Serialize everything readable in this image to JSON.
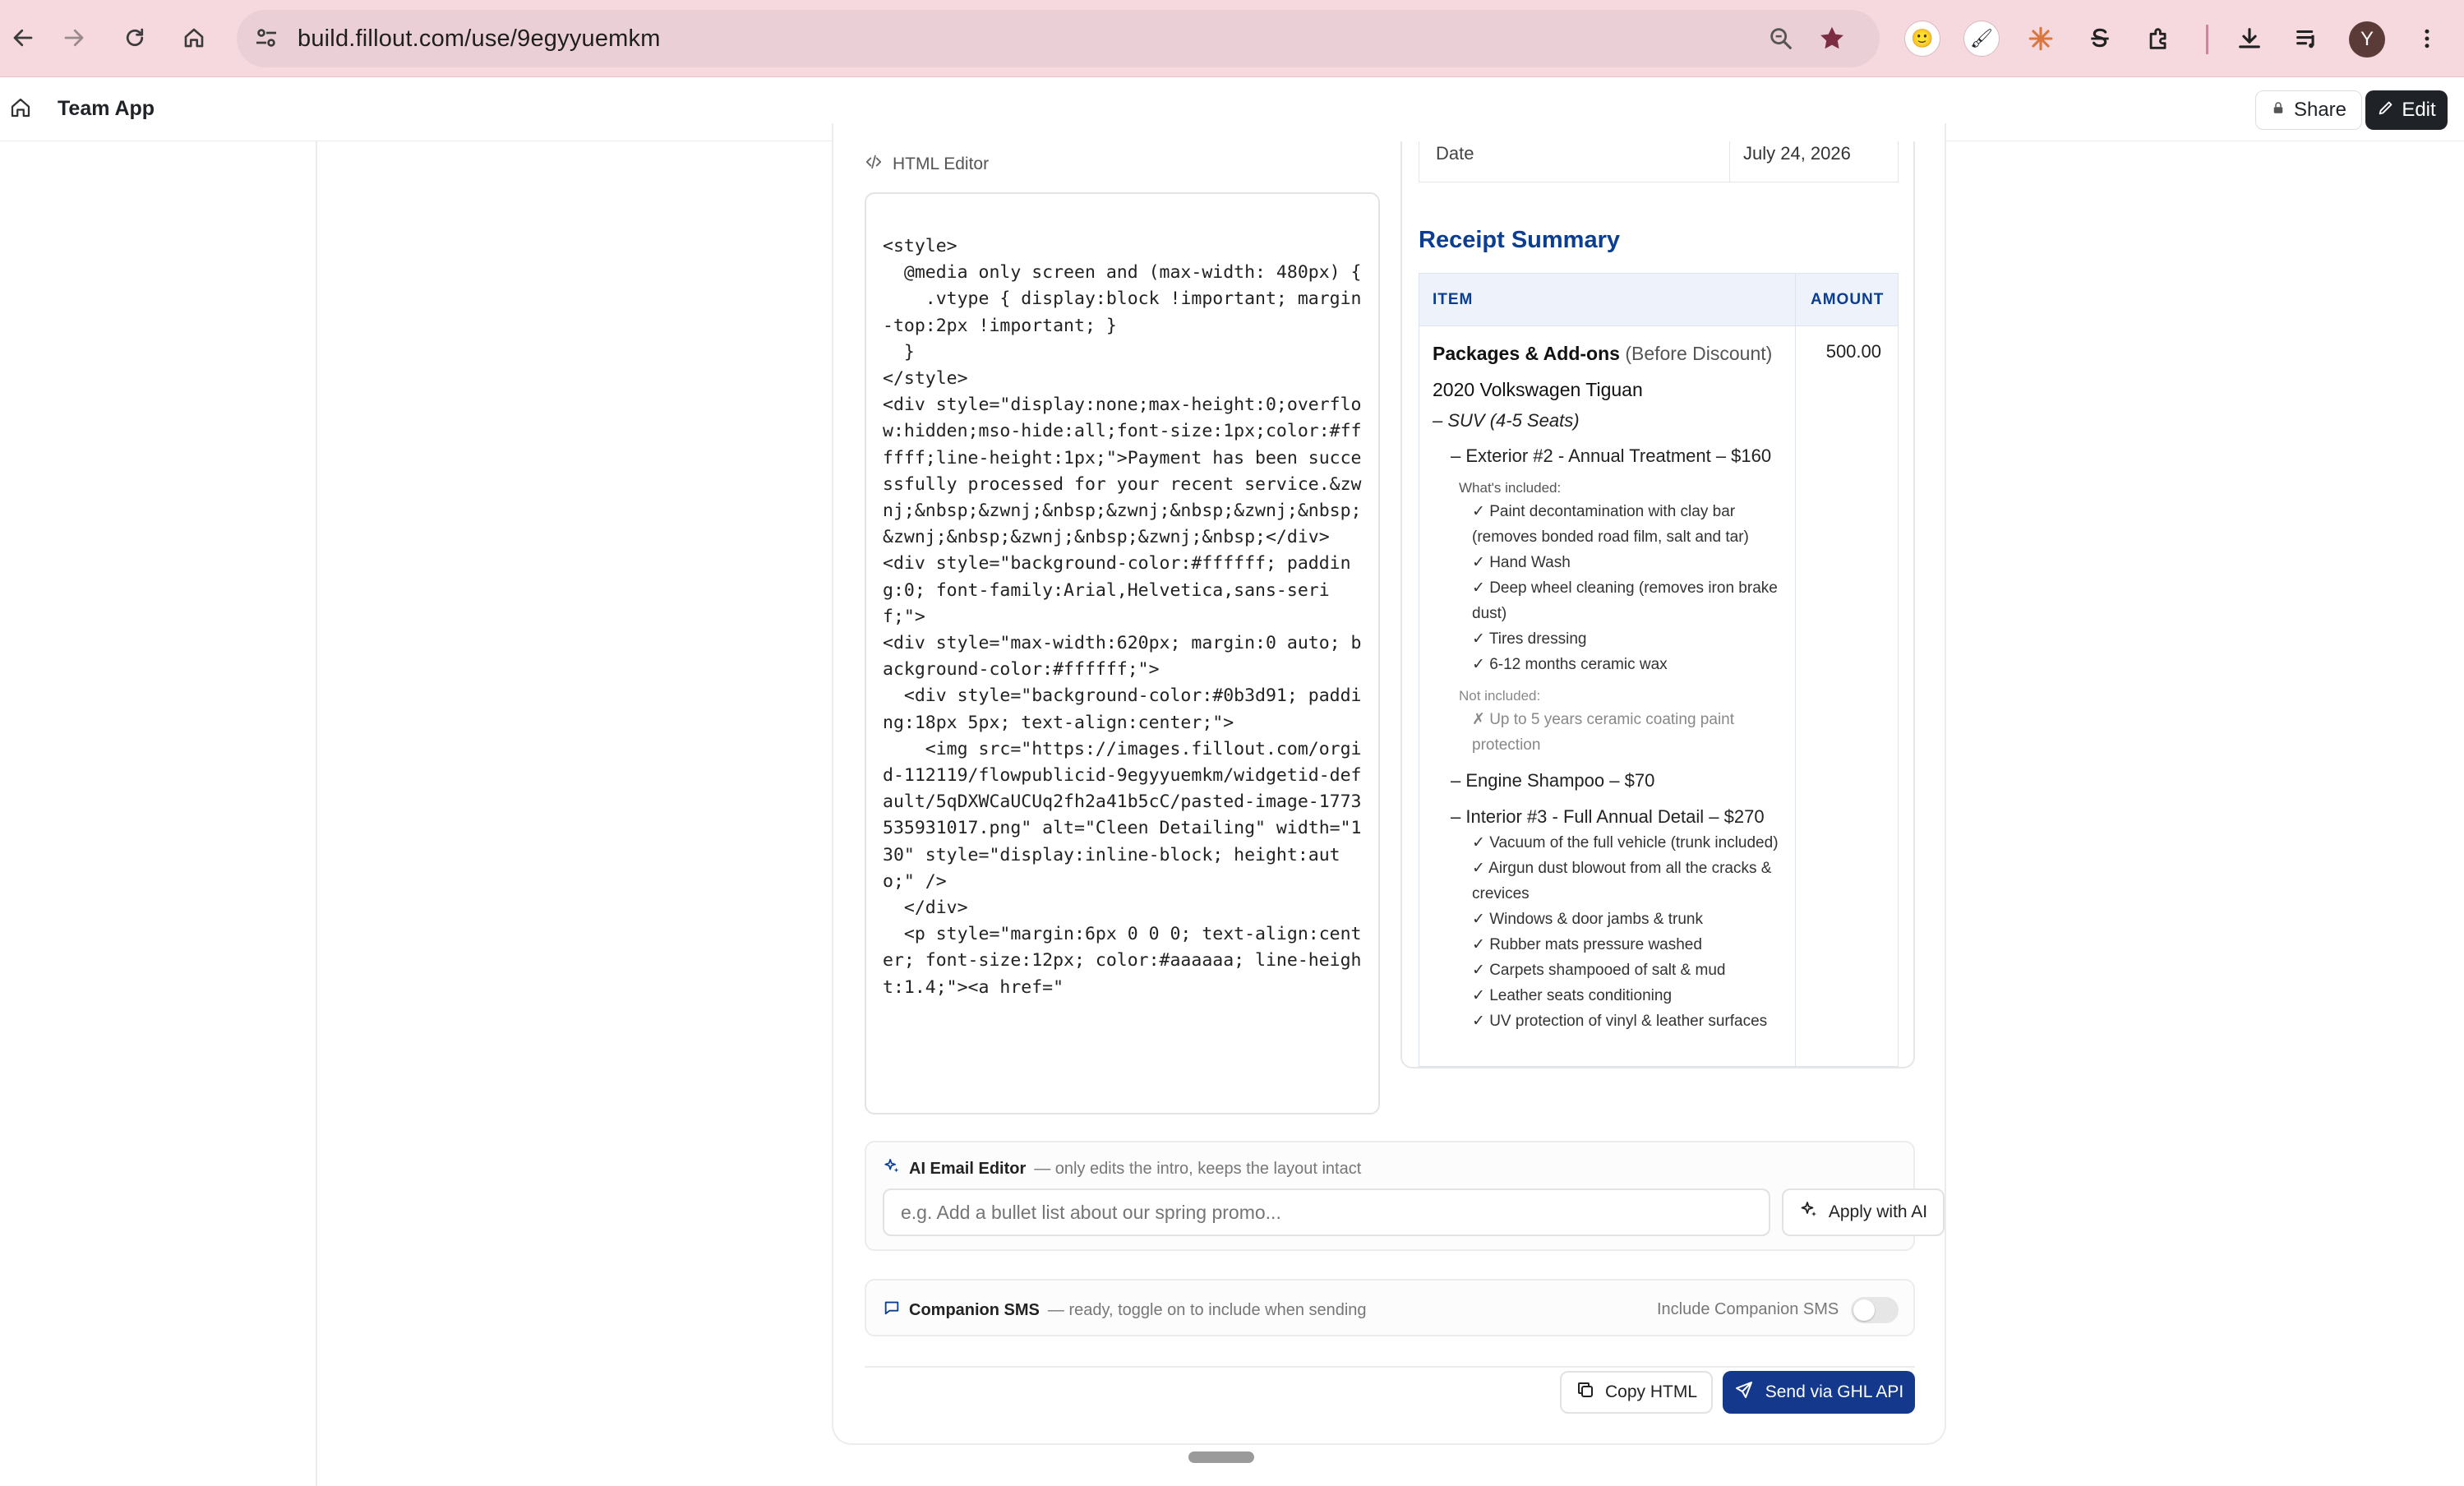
{
  "browser": {
    "url": "build.fillout.com/use/9egyyuemkm",
    "avatar_letter": "Y",
    "accent_color": "#f5d9df"
  },
  "app": {
    "title": "Team App",
    "share_label": "Share",
    "edit_label": "Edit"
  },
  "html_editor": {
    "label": "HTML Editor",
    "code": "<style>\n  @media only screen and (max-width: 480px) {\n    .vtype { display:block !important; margin-top:2px !important; }\n  }\n</style>\n<div style=\"display:none;max-height:0;overflow:hidden;mso-hide:all;font-size:1px;color:#ffffff;line-height:1px;\">Payment has been successfully processed for your recent service.&zwnj;&nbsp;&zwnj;&nbsp;&zwnj;&nbsp;&zwnj;&nbsp;&zwnj;&nbsp;&zwnj;&nbsp;&zwnj;&nbsp;</div>\n<div style=\"background-color:#ffffff; padding:0; font-family:Arial,Helvetica,sans-serif;\">\n<div style=\"max-width:620px; margin:0 auto; background-color:#ffffff;\">\n  <div style=\"background-color:#0b3d91; padding:18px 5px; text-align:center;\">\n    <img src=\"https://images.fillout.com/orgid-112119/flowpublicid-9egyyuemkm/widgetid-default/5qDXWCaUCUq2fh2a41b5cC/pasted-image-1773535931017.png\" alt=\"Cleen Detailing\" width=\"130\" style=\"display:inline-block; height:auto;\" />\n  </div>\n  <p style=\"margin:6px 0 0 0; text-align:center; font-size:12px; color:#aaaaaa; line-height:1.4;\"><a href=\""
  },
  "preview": {
    "date_label": "Date",
    "date_value": "July 24, 2026",
    "receipt_title": "Receipt Summary",
    "col_item": "ITEM",
    "col_amount": "AMOUNT",
    "package_bold": "Packages & Add-ons",
    "package_note": "(Before Discount)",
    "package_amount": "500.00",
    "vehicle": "2020 Volkswagen Tiguan",
    "vehicle_type": "– SUV (4-5 Seats)",
    "service1": "– Exterior #2 - Annual Treatment – $160",
    "included_label": "What's included:",
    "included": [
      "✓ Paint decontamination with clay bar (removes bonded road film, salt and tar)",
      "✓ Hand Wash",
      "✓ Deep wheel cleaning (removes iron brake dust)",
      "✓ Tires dressing",
      "✓ 6-12 months ceramic wax"
    ],
    "not_included_label": "Not included:",
    "not_included": [
      "✗ Up to 5 years ceramic coating paint protection"
    ],
    "service2": "– Engine Shampoo – $70",
    "service3": "– Interior #3 - Full Annual Detail – $270",
    "interior_items": [
      "✓ Vacuum of the full vehicle (trunk included)",
      "✓ Airgun dust blowout from all the cracks & crevices",
      "✓ Windows & door jambs & trunk",
      "✓ Rubber mats pressure washed",
      "✓ Carpets shampooed of salt & mud",
      "✓ Leather seats conditioning",
      "✓ UV protection of vinyl & leather surfaces"
    ],
    "title_color": "#0b3d91"
  },
  "ai_editor": {
    "title": "AI Email Editor",
    "subtitle": "— only edits the intro, keeps the layout intact",
    "placeholder": "e.g. Add a bullet list about our spring promo...",
    "apply_label": "Apply with AI"
  },
  "sms": {
    "title": "Companion SMS",
    "subtitle": "— ready, toggle on to include when sending",
    "toggle_label": "Include Companion SMS",
    "toggle_on": false
  },
  "actions": {
    "copy_label": "Copy HTML",
    "send_label": "Send via GHL API",
    "send_color": "#14398c"
  }
}
